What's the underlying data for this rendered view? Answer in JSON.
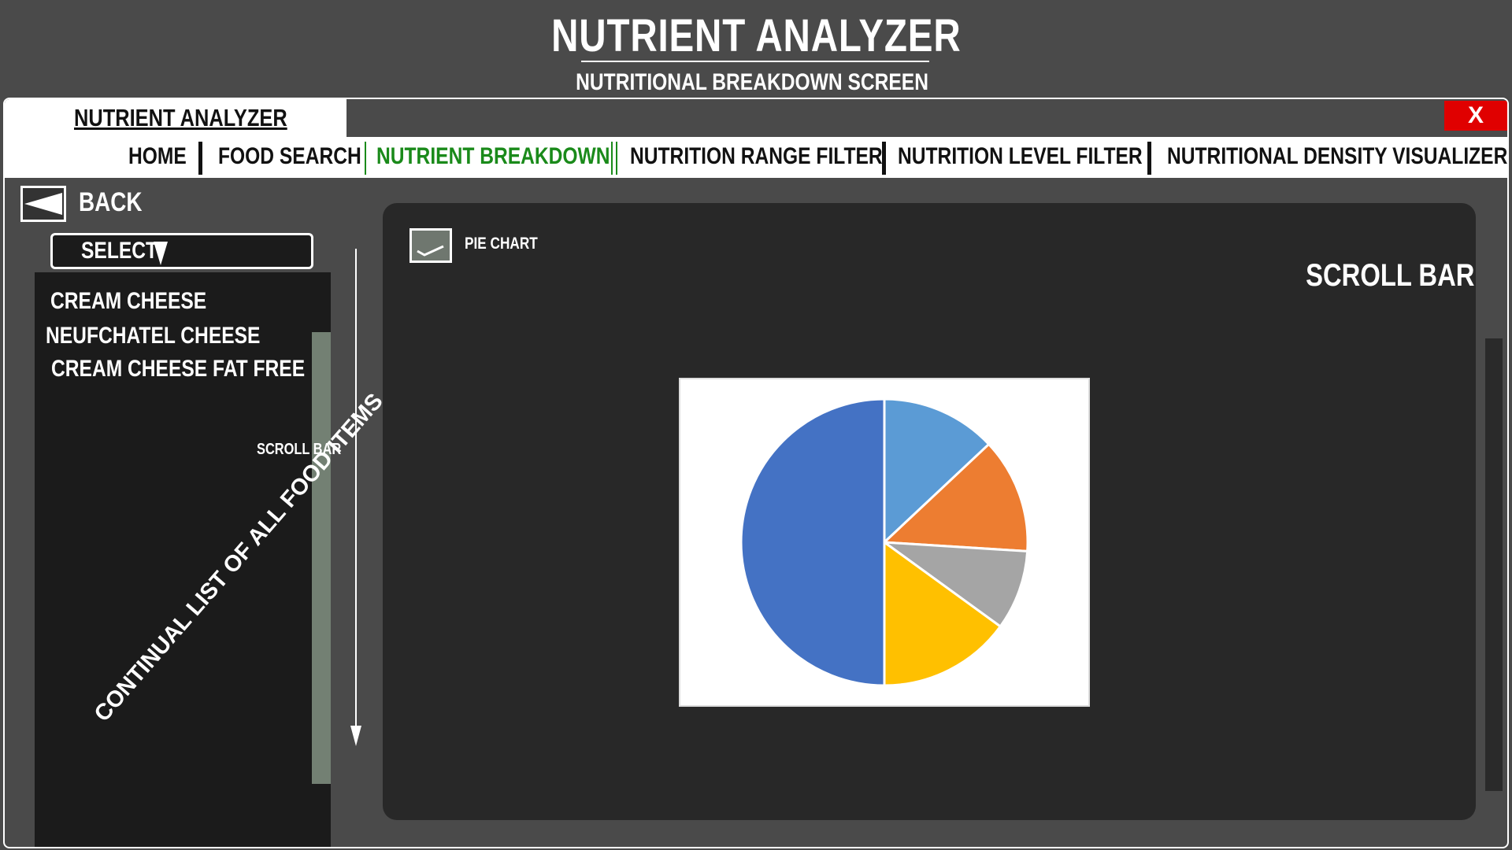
{
  "header": {
    "app_title": "NUTRIENT ANALYZER",
    "screen_subtitle": "NUTRITIONAL BREAKDOWN SCREEN"
  },
  "window": {
    "tab_label": "NUTRIENT ANALYZER",
    "close_label": "X"
  },
  "nav": {
    "items": [
      {
        "label": "HOME"
      },
      {
        "label": "FOOD SEARCH"
      },
      {
        "label": "NUTRIENT BREAKDOWN",
        "active": true
      },
      {
        "label": "NUTRITION RANGE FILTER"
      },
      {
        "label": "NUTRITION LEVEL FILTER"
      },
      {
        "label": "NUTRITIONAL DENSITY VISUALIZER"
      }
    ],
    "active_color": "#1a8a1a"
  },
  "left_panel": {
    "back_label": "BACK",
    "select_label": "SELECT",
    "food_items": [
      "CREAM CHEESE",
      "NEUFCHATEL CHEESE",
      "CREAM CHEESE FAT FREE"
    ],
    "scroll_label": "SCROLL BAR",
    "list_annotation": "CONTINUAL LIST OF ALL FOOD ITEMS"
  },
  "main_panel": {
    "pie_checkbox_label": "PIE CHART",
    "pie_checked": true,
    "scroll_label": "SCROLL BAR"
  },
  "chart_data": {
    "type": "pie",
    "values": [
      13,
      13,
      9,
      15,
      50
    ],
    "colors": [
      "#5b9bd5",
      "#ed7d31",
      "#a5a5a5",
      "#ffc000",
      "#4472c4"
    ]
  },
  "colors": {
    "background": "#4a4a4a",
    "panel": "#282828",
    "close": "#e00000",
    "scrollbar": "#738073"
  }
}
